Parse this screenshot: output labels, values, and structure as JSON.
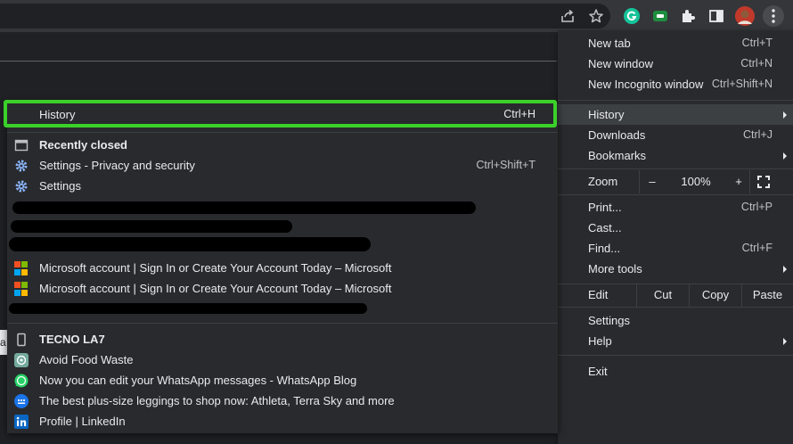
{
  "main_menu": {
    "new_tab": {
      "label": "New tab",
      "shortcut": "Ctrl+T"
    },
    "new_window": {
      "label": "New window",
      "shortcut": "Ctrl+N"
    },
    "new_incognito": {
      "label": "New Incognito window",
      "shortcut": "Ctrl+Shift+N"
    },
    "history": {
      "label": "History"
    },
    "downloads": {
      "label": "Downloads",
      "shortcut": "Ctrl+J"
    },
    "bookmarks": {
      "label": "Bookmarks"
    },
    "zoom": {
      "label": "Zoom",
      "minus": "–",
      "value": "100%",
      "plus": "+"
    },
    "print": {
      "label": "Print...",
      "shortcut": "Ctrl+P"
    },
    "cast": {
      "label": "Cast..."
    },
    "find": {
      "label": "Find...",
      "shortcut": "Ctrl+F"
    },
    "more_tools": {
      "label": "More tools"
    },
    "edit": {
      "label": "Edit",
      "cut": "Cut",
      "copy": "Copy",
      "paste": "Paste"
    },
    "settings": {
      "label": "Settings"
    },
    "help": {
      "label": "Help"
    },
    "exit": {
      "label": "Exit"
    }
  },
  "history_menu": {
    "header": {
      "label": "History",
      "shortcut": "Ctrl+H"
    },
    "recently_closed": "Recently closed",
    "items": [
      {
        "label": "Settings - Privacy and security",
        "shortcut": "Ctrl+Shift+T"
      },
      {
        "label": "Settings"
      },
      {
        "label": "Microsoft account | Sign In or Create Your Account Today – Microsoft"
      },
      {
        "label": "Microsoft account | Sign In or Create Your Account Today – Microsoft"
      }
    ],
    "device": "TECNO LA7",
    "device_items": [
      {
        "label": "Avoid Food Waste"
      },
      {
        "label": "Now you can edit your WhatsApp messages - WhatsApp Blog"
      },
      {
        "label": "The best plus-size leggings to shop now: Athleta, Terra  Sky and more"
      },
      {
        "label": "Profile | LinkedIn"
      }
    ]
  },
  "page": {
    "fragment_text": "a"
  },
  "colors": {
    "highlight_box": "#3bd02a",
    "menu_bg": "#292a2d",
    "accent": "#8ab4f8"
  }
}
